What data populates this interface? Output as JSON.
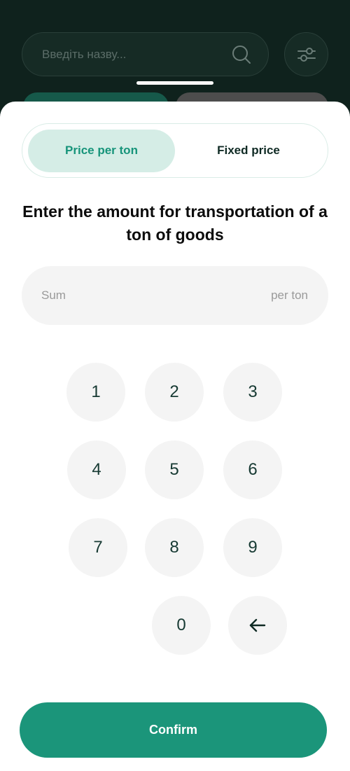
{
  "background": {
    "search_placeholder": "Введіть назву...",
    "icons": [
      "search-icon",
      "filter-icon"
    ]
  },
  "sheet": {
    "tabs": [
      {
        "label": "Price per ton",
        "active": true
      },
      {
        "label": "Fixed price",
        "active": false
      }
    ],
    "heading": "Enter the amount for transportation of a ton of goods",
    "sum_field": {
      "placeholder": "Sum",
      "unit": "per ton",
      "value": ""
    },
    "keypad": [
      "1",
      "2",
      "3",
      "4",
      "5",
      "6",
      "7",
      "8",
      "9",
      "0"
    ],
    "backspace_icon": "arrow-left-icon",
    "confirm_label": "Confirm"
  },
  "colors": {
    "accent": "#1b957a",
    "active_tab_bg": "#d5ede6",
    "active_tab_text": "#16947a"
  }
}
